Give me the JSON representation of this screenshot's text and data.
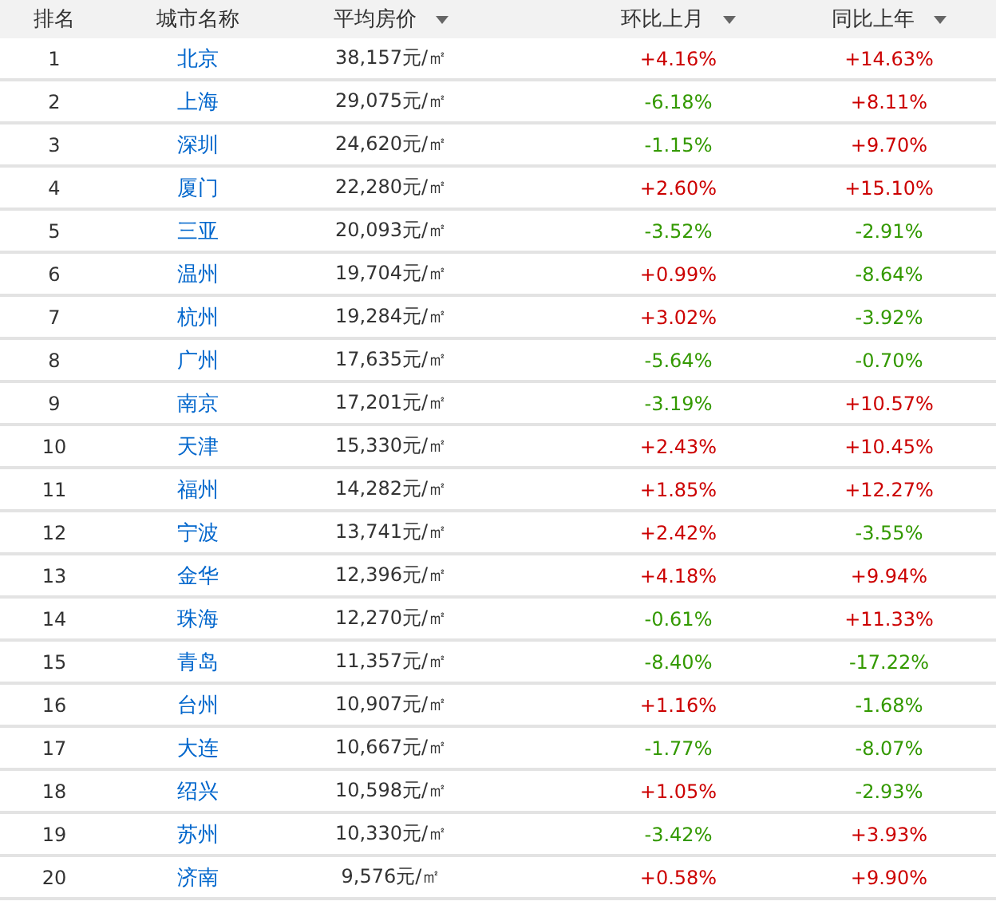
{
  "table": {
    "columns": [
      {
        "label": "排名",
        "sortable": false
      },
      {
        "label": "城市名称",
        "sortable": false
      },
      {
        "label": "平均房价",
        "sortable": true
      },
      {
        "label": "环比上月",
        "sortable": true
      },
      {
        "label": "同比上年",
        "sortable": true
      }
    ],
    "rows": [
      {
        "rank": "1",
        "city": "北京",
        "price": "38,157元/㎡",
        "mom": {
          "text": "+4.16%",
          "color": "#cc0000"
        },
        "yoy": {
          "text": "+14.63%",
          "color": "#cc0000"
        }
      },
      {
        "rank": "2",
        "city": "上海",
        "price": "29,075元/㎡",
        "mom": {
          "text": "-6.18%",
          "color": "#339900"
        },
        "yoy": {
          "text": "+8.11%",
          "color": "#cc0000"
        }
      },
      {
        "rank": "3",
        "city": "深圳",
        "price": "24,620元/㎡",
        "mom": {
          "text": "-1.15%",
          "color": "#339900"
        },
        "yoy": {
          "text": "+9.70%",
          "color": "#cc0000"
        }
      },
      {
        "rank": "4",
        "city": "厦门",
        "price": "22,280元/㎡",
        "mom": {
          "text": "+2.60%",
          "color": "#cc0000"
        },
        "yoy": {
          "text": "+15.10%",
          "color": "#cc0000"
        }
      },
      {
        "rank": "5",
        "city": "三亚",
        "price": "20,093元/㎡",
        "mom": {
          "text": "-3.52%",
          "color": "#339900"
        },
        "yoy": {
          "text": "-2.91%",
          "color": "#339900"
        }
      },
      {
        "rank": "6",
        "city": "温州",
        "price": "19,704元/㎡",
        "mom": {
          "text": "+0.99%",
          "color": "#cc0000"
        },
        "yoy": {
          "text": "-8.64%",
          "color": "#339900"
        }
      },
      {
        "rank": "7",
        "city": "杭州",
        "price": "19,284元/㎡",
        "mom": {
          "text": "+3.02%",
          "color": "#cc0000"
        },
        "yoy": {
          "text": "-3.92%",
          "color": "#339900"
        }
      },
      {
        "rank": "8",
        "city": "广州",
        "price": "17,635元/㎡",
        "mom": {
          "text": "-5.64%",
          "color": "#339900"
        },
        "yoy": {
          "text": "-0.70%",
          "color": "#339900"
        }
      },
      {
        "rank": "9",
        "city": "南京",
        "price": "17,201元/㎡",
        "mom": {
          "text": "-3.19%",
          "color": "#339900"
        },
        "yoy": {
          "text": "+10.57%",
          "color": "#cc0000"
        }
      },
      {
        "rank": "10",
        "city": "天津",
        "price": "15,330元/㎡",
        "mom": {
          "text": "+2.43%",
          "color": "#cc0000"
        },
        "yoy": {
          "text": "+10.45%",
          "color": "#cc0000"
        }
      },
      {
        "rank": "11",
        "city": "福州",
        "price": "14,282元/㎡",
        "mom": {
          "text": "+1.85%",
          "color": "#cc0000"
        },
        "yoy": {
          "text": "+12.27%",
          "color": "#cc0000"
        }
      },
      {
        "rank": "12",
        "city": "宁波",
        "price": "13,741元/㎡",
        "mom": {
          "text": "+2.42%",
          "color": "#cc0000"
        },
        "yoy": {
          "text": "-3.55%",
          "color": "#339900"
        }
      },
      {
        "rank": "13",
        "city": "金华",
        "price": "12,396元/㎡",
        "mom": {
          "text": "+4.18%",
          "color": "#cc0000"
        },
        "yoy": {
          "text": "+9.94%",
          "color": "#cc0000"
        }
      },
      {
        "rank": "14",
        "city": "珠海",
        "price": "12,270元/㎡",
        "mom": {
          "text": "-0.61%",
          "color": "#339900"
        },
        "yoy": {
          "text": "+11.33%",
          "color": "#cc0000"
        }
      },
      {
        "rank": "15",
        "city": "青岛",
        "price": "11,357元/㎡",
        "mom": {
          "text": "-8.40%",
          "color": "#339900"
        },
        "yoy": {
          "text": "-17.22%",
          "color": "#339900"
        }
      },
      {
        "rank": "16",
        "city": "台州",
        "price": "10,907元/㎡",
        "mom": {
          "text": "+1.16%",
          "color": "#cc0000"
        },
        "yoy": {
          "text": "-1.68%",
          "color": "#339900"
        }
      },
      {
        "rank": "17",
        "city": "大连",
        "price": "10,667元/㎡",
        "mom": {
          "text": "-1.77%",
          "color": "#339900"
        },
        "yoy": {
          "text": "-8.07%",
          "color": "#339900"
        }
      },
      {
        "rank": "18",
        "city": "绍兴",
        "price": "10,598元/㎡",
        "mom": {
          "text": "+1.05%",
          "color": "#cc0000"
        },
        "yoy": {
          "text": "-2.93%",
          "color": "#339900"
        }
      },
      {
        "rank": "19",
        "city": "苏州",
        "price": "10,330元/㎡",
        "mom": {
          "text": "-3.42%",
          "color": "#339900"
        },
        "yoy": {
          "text": "+3.93%",
          "color": "#cc0000"
        }
      },
      {
        "rank": "20",
        "city": "济南",
        "price": "9,576元/㎡",
        "mom": {
          "text": "+0.58%",
          "color": "#cc0000"
        },
        "yoy": {
          "text": "+9.90%",
          "color": "#cc0000"
        }
      }
    ]
  }
}
